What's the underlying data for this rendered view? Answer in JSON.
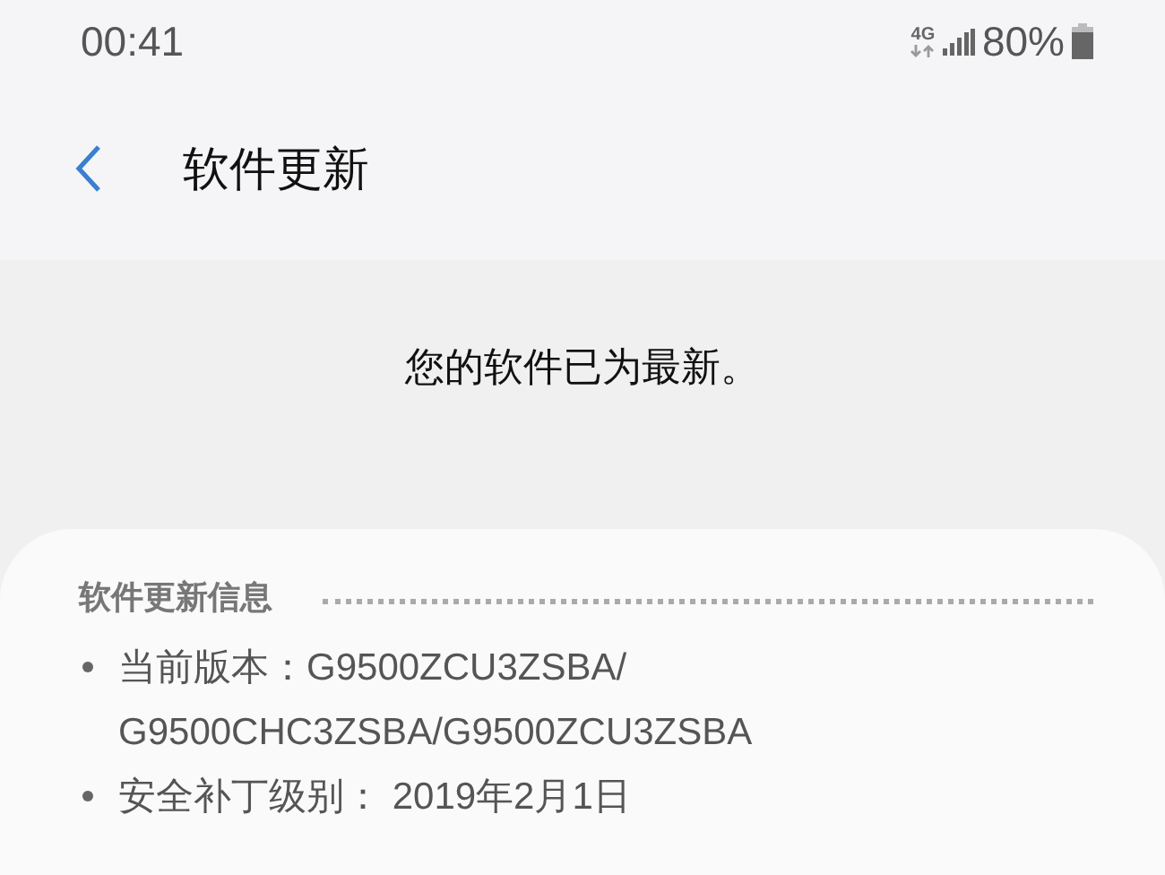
{
  "status_bar": {
    "time": "00:41",
    "network": "4G",
    "battery": "80%"
  },
  "header": {
    "title": "软件更新"
  },
  "message": "您的软件已为最新。",
  "info_card": {
    "title": "软件更新信息",
    "items": [
      {
        "label": "当前版本：",
        "lines": [
          "G9500ZCU3ZSBA/",
          "G9500CHC3ZSBA/G9500ZCU3ZSBA"
        ]
      },
      {
        "label": "安全补丁级别：",
        "lines": [
          " 2019年2月1日"
        ]
      }
    ]
  }
}
